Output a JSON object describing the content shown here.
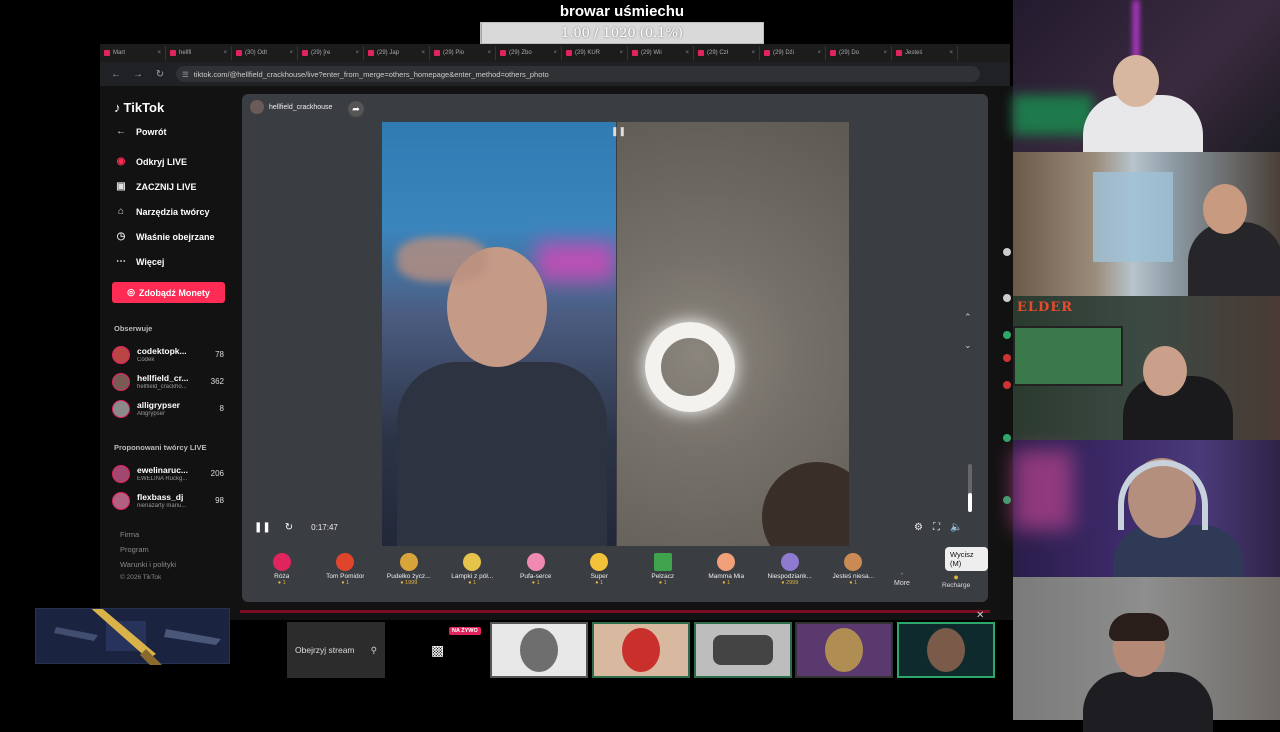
{
  "overlay": {
    "goal_title": "browar uśmiechu",
    "goal_text": "1.00 / 1020 (0.1%)",
    "goal_fraction": 0.001
  },
  "browser": {
    "tabs": [
      "Mart",
      "hellfi",
      "(30) Odt",
      "(29) [re",
      "(29) Jap",
      "(29) Pio",
      "(29) Zbo",
      "(29) KUR",
      "(29) Wii",
      "(29) Czł",
      "(29) Dźi",
      "(29) Do",
      "Jesteś"
    ],
    "url": "tiktok.com/@hellfield_crackhouse/live?enter_from_merge=others_homepage&enter_method=others_photo"
  },
  "sidebar": {
    "logo": "TikTok",
    "back": "Powrót",
    "nav": [
      {
        "label": "Odkryj LIVE",
        "icon": "live-icon"
      },
      {
        "label": "ZACZNIJ LIVE",
        "icon": "camera-icon"
      },
      {
        "label": "Narzędzia twórcy",
        "icon": "house-icon"
      },
      {
        "label": "Właśnie obejrzane",
        "icon": "history-icon"
      },
      {
        "label": "Więcej",
        "icon": "more-icon"
      }
    ],
    "coins_button": "Zdobądź Monety",
    "following_title": "Obserwuje",
    "following": [
      {
        "name": "codektopk...",
        "sub": "Codek",
        "count": "78"
      },
      {
        "name": "hellfield_cr...",
        "sub": "hellfield_crackho...",
        "count": "362"
      },
      {
        "name": "alligrypser",
        "sub": "Alligrypser",
        "count": "8"
      }
    ],
    "suggested_title": "Proponowani twórcy LIVE",
    "suggested": [
      {
        "name": "ewelinaruc...",
        "sub": "EWELINA Ruckg...",
        "count": "206"
      },
      {
        "name": "flexbass_dj",
        "sub": "nienażarty mariu...",
        "count": "98"
      }
    ],
    "footer": [
      "Firma",
      "Program",
      "Warunki i polityki",
      "© 2026 TikTok"
    ]
  },
  "player": {
    "host": "hellfield_crackhouse",
    "timer": "0:17:47",
    "tooltip": "Wycisz (M)",
    "volume_level": 0.4,
    "more_label": "More",
    "recharge_label": "Recharge",
    "gifts": [
      {
        "name": "Róża",
        "price": "1",
        "color": "#e0245e"
      },
      {
        "name": "Tom Pomidor",
        "price": "1",
        "color": "#e0452b"
      },
      {
        "name": "Pudełko życz...",
        "price": "1999",
        "color": "#d9a53a"
      },
      {
        "name": "Lampki z pół...",
        "price": "1",
        "color": "#e6c34a"
      },
      {
        "name": "Pufa-serce",
        "price": "1",
        "color": "#f08ab0"
      },
      {
        "name": "Super",
        "price": "1",
        "color": "#f2c23a"
      },
      {
        "name": "Pełzacz",
        "price": "1",
        "color": "#3fa34d"
      },
      {
        "name": "Mamma Mia",
        "price": "1",
        "color": "#f1a07a"
      },
      {
        "name": "Niespodziank...",
        "price": "2999",
        "color": "#8e7bd1"
      },
      {
        "name": "Jesteś niesa...",
        "price": "1",
        "color": "#c98a54"
      }
    ]
  },
  "bottom": {
    "watch_stream": "Obejrzyj stream",
    "live_badge": "NA ŻYWO"
  },
  "colors": {
    "accent": "#fe2c55",
    "player_bg": "#3a3d42",
    "thumb_border": "#2e6b4a"
  }
}
